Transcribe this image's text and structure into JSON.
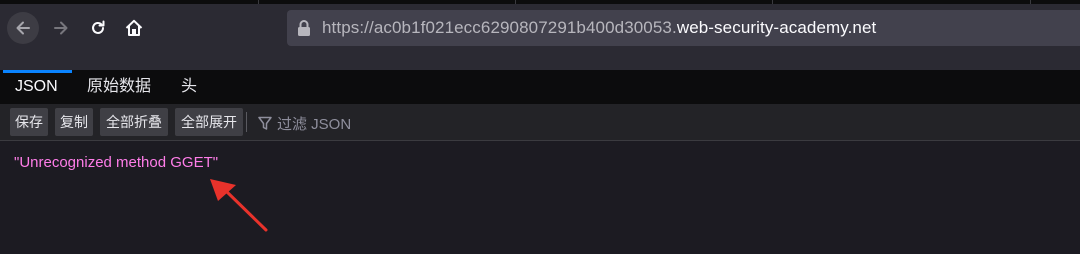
{
  "browser": {
    "url_prefix": "https://ac0b1f021ecc6290807291b400d30053.",
    "url_host": "web-security-academy.net",
    "icons": {
      "back": "arrow-left-icon",
      "forward": "arrow-right-icon",
      "reload": "reload-icon",
      "home": "home-icon",
      "lock": "lock-icon"
    }
  },
  "viewer": {
    "tabs": [
      {
        "label": "JSON",
        "active": true
      },
      {
        "label": "原始数据",
        "active": false
      },
      {
        "label": "头",
        "active": false
      }
    ],
    "toolbar": {
      "save_label": "保存",
      "copy_label": "复制",
      "collapse_all_label": "全部折叠",
      "expand_all_label": "全部展开",
      "filter_placeholder": "过滤 JSON"
    },
    "json_value": "\"Unrecognized method GGET\"",
    "colors": {
      "string": "#ff7de9",
      "annotation_arrow": "#e8322b",
      "active_tab": "#0a84ff"
    }
  }
}
